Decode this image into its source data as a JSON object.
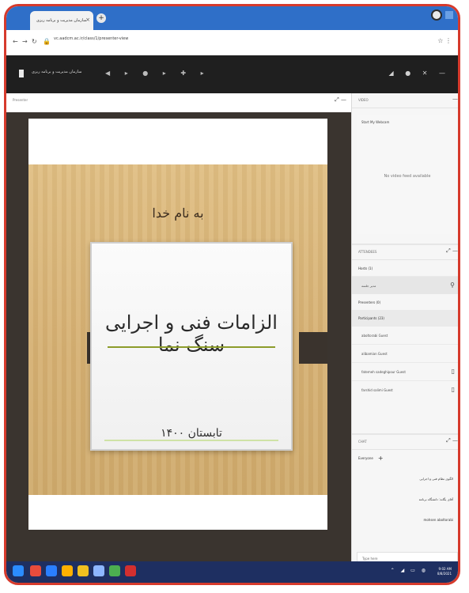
{
  "browser": {
    "tab_title": "سازمان مدیریت و برنامه ریزی",
    "tab_close": "×",
    "new_tab": "+",
    "url": "vc.aadcm.ac.ir/class/1/presenter-view"
  },
  "topbar": {
    "org_title": "سازمان مدیریت و برنامه ریزی"
  },
  "presenter": {
    "header": "Presenter",
    "controls": "⤢  —"
  },
  "slide": {
    "basmala": "به نام خدا",
    "title": "الزامات فنی و اجرایی سنگ نما",
    "footer": "تابستان ۱۴۰۰"
  },
  "video": {
    "header": "VIDEO",
    "toggle_label": "Start My Webcam",
    "message": "No video feed available"
  },
  "attendees": {
    "header": "ATTENDEES",
    "hosts_label": "Hosts (1)",
    "host_name": "مدیر جلسه",
    "presenters_label": "Presenters (0)",
    "participants_label": "Participants (23)",
    "participants": [
      "aboltorabi Guest",
      "alibamian Guest",
      "fatemeh sadeghipour Guest",
      "farshid salimi Guest"
    ]
  },
  "chat": {
    "header": "CHAT",
    "filter_label": "Everyone",
    "messages": [
      "الگوی نظام فنی و اجرایی",
      "آقای یگانه: دانشگاه برنامه",
      "mohsen aboltorabi"
    ],
    "input_placeholder": "Type here"
  },
  "taskbar": {
    "time": "9:02 AM",
    "date": "8/8/2021"
  }
}
